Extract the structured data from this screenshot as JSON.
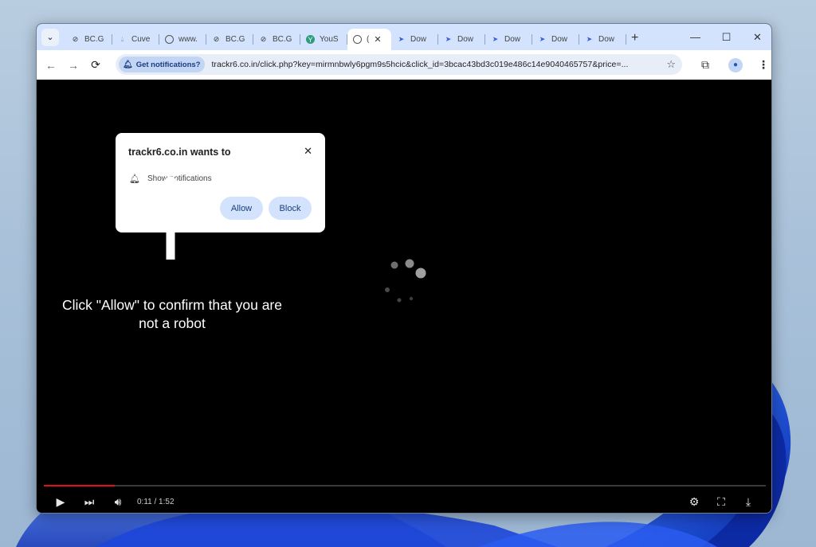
{
  "tabs": [
    {
      "label": "BC.G",
      "favicon": "bc-icon"
    },
    {
      "label": "Cuve",
      "favicon": "water-drop-icon"
    },
    {
      "label": "www.",
      "favicon": "globe-icon"
    },
    {
      "label": "BC.G",
      "favicon": "bc-icon"
    },
    {
      "label": "BC.G",
      "favicon": "bc-icon"
    },
    {
      "label": "YouS",
      "favicon": "youtube-icon"
    },
    {
      "label": "(",
      "favicon": "globe-icon",
      "active": true
    },
    {
      "label": "Dow",
      "favicon": "send-icon"
    },
    {
      "label": "Dow",
      "favicon": "send-icon"
    },
    {
      "label": "Dow",
      "favicon": "send-icon"
    },
    {
      "label": "Dow",
      "favicon": "send-icon"
    },
    {
      "label": "Dow",
      "favicon": "send-icon"
    }
  ],
  "toolbar": {
    "notif_chip_label": "Get notifications?",
    "url": "trackr6.co.in/click.php?key=mirmnbwly6pgm9s5hcic&click_id=3bcac43bd3c019e486c14e9040465757&price=..."
  },
  "prompt": {
    "title": "trackr6.co.in wants to",
    "permission": "Show notifications",
    "allow_label": "Allow",
    "block_label": "Block"
  },
  "page": {
    "instruction": "Click \"Allow\" to confirm that you are not a robot"
  },
  "player": {
    "time": "0:11 / 1:52",
    "progress_fraction": 0.098
  },
  "colors": {
    "tabstrip": "#d3e3fd",
    "chip": "#c2d5f5",
    "progress": "#e1111a",
    "wallpaper_accent": "#1f4fd6"
  }
}
